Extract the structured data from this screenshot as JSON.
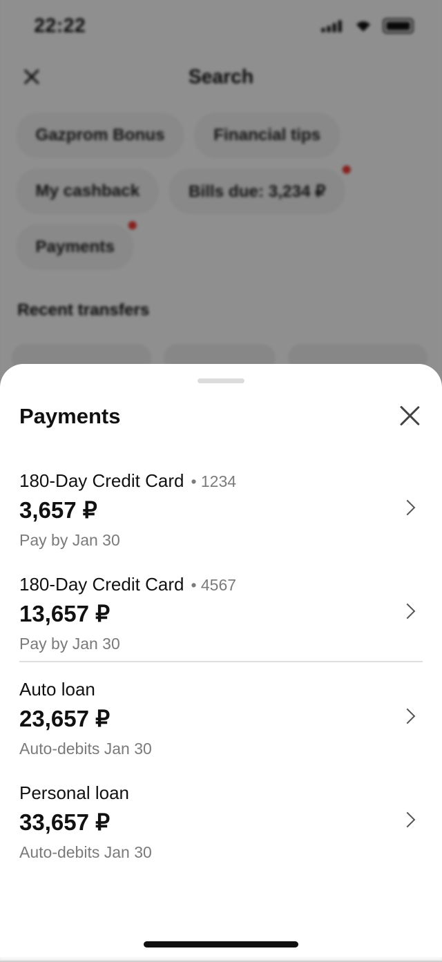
{
  "status_bar": {
    "time": "22:22"
  },
  "background": {
    "title": "Search",
    "chips": [
      {
        "label": "Gazprom Bonus",
        "dot": false
      },
      {
        "label": "Financial tips",
        "dot": false
      },
      {
        "label": "My cashback",
        "dot": false
      },
      {
        "label": "Bills due: 3,234 ₽",
        "dot": true
      },
      {
        "label": "Payments",
        "dot": true
      }
    ],
    "section_title": "Recent transfers"
  },
  "sheet": {
    "title": "Payments",
    "items": [
      {
        "name": "180-Day Credit Card",
        "suffix": "• 1234",
        "amount": "3,657 ₽",
        "subtitle": "Pay by Jan 30"
      },
      {
        "name": "180-Day Credit Card",
        "suffix": "• 4567",
        "amount": "13,657 ₽",
        "subtitle": "Pay by Jan 30"
      },
      {
        "name": "Auto loan",
        "suffix": "",
        "amount": "23,657 ₽",
        "subtitle": "Auto-debits Jan 30"
      },
      {
        "name": "Personal loan",
        "suffix": "",
        "amount": "33,657 ₽",
        "subtitle": "Auto-debits Jan 30"
      }
    ]
  },
  "colors": {
    "notification_dot": "#e53935",
    "overlay": "rgba(0,0,0,0.42)"
  }
}
